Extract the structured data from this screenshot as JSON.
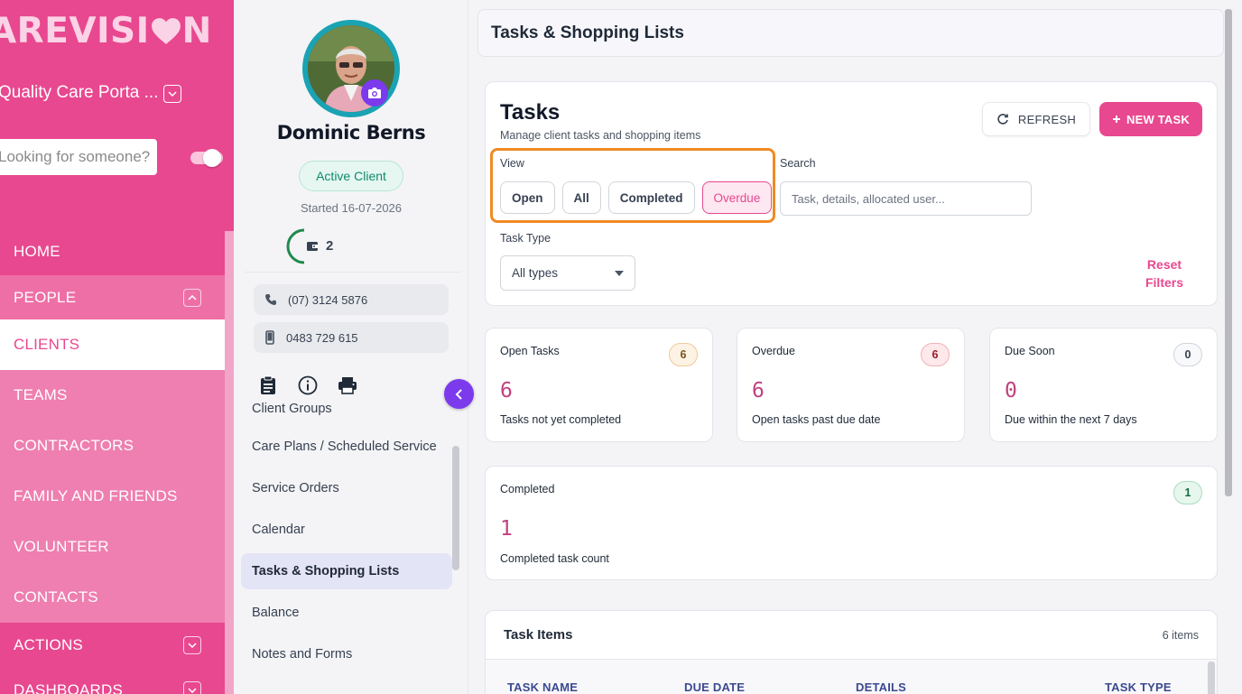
{
  "brand": {
    "logo_left": "AREVISI",
    "logo_right": "N",
    "portal": "Quality Care Porta ...",
    "search_placeholder": "Looking for someone?",
    "accent": "#e8488f"
  },
  "nav": {
    "home": "HOME",
    "people": "PEOPLE",
    "clients": "CLIENTS",
    "teams": "TEAMS",
    "contractors": "CONTRACTORS",
    "family": "FAMILY AND FRIENDS",
    "volunteer": "VOLUNTEER",
    "contacts": "CONTACTS",
    "actions": "ACTIONS",
    "dashboards": "DASHBOARDS"
  },
  "client": {
    "name": "Dominic Berns",
    "status": "Active Client",
    "started": "Started 16-07-2026",
    "wallet_count": "2",
    "phone": "(07) 3124 5876",
    "mobile": "0483 729 615",
    "menu": {
      "client_groups": "Client Groups",
      "care_plans": "Care Plans / Scheduled Service",
      "service_orders": "Service Orders",
      "calendar": "Calendar",
      "tasks": "Tasks & Shopping Lists",
      "balance": "Balance",
      "notes": "Notes and Forms"
    }
  },
  "page": {
    "header": "Tasks & Shopping Lists"
  },
  "tasks": {
    "title": "Tasks",
    "subtitle": "Manage client tasks and shopping items",
    "refresh": "REFRESH",
    "new_task": "NEW TASK",
    "view_label": "View",
    "views": {
      "open": "Open",
      "all": "All",
      "completed": "Completed",
      "overdue": "Overdue"
    },
    "selected_view": "Overdue",
    "search_label": "Search",
    "search_placeholder": "Task, details, allocated user...",
    "type_label": "Task Type",
    "type_value": "All types",
    "reset_line1": "Reset",
    "reset_line2": "Filters"
  },
  "stats": {
    "open": {
      "title": "Open Tasks",
      "badge": "6",
      "value": "6",
      "desc": "Tasks not yet completed"
    },
    "overdue": {
      "title": "Overdue",
      "badge": "6",
      "value": "6",
      "desc": "Open tasks past due date"
    },
    "soon": {
      "title": "Due Soon",
      "badge": "0",
      "value": "0",
      "desc": "Due within the next 7 days"
    },
    "completed": {
      "title": "Completed",
      "badge": "1",
      "value": "1",
      "desc": "Completed task count"
    }
  },
  "items": {
    "title": "Task Items",
    "count": "6 items",
    "columns": {
      "name": "TASK NAME",
      "due": "DUE DATE",
      "details": "DETAILS",
      "type": "TASK TYPE"
    }
  }
}
